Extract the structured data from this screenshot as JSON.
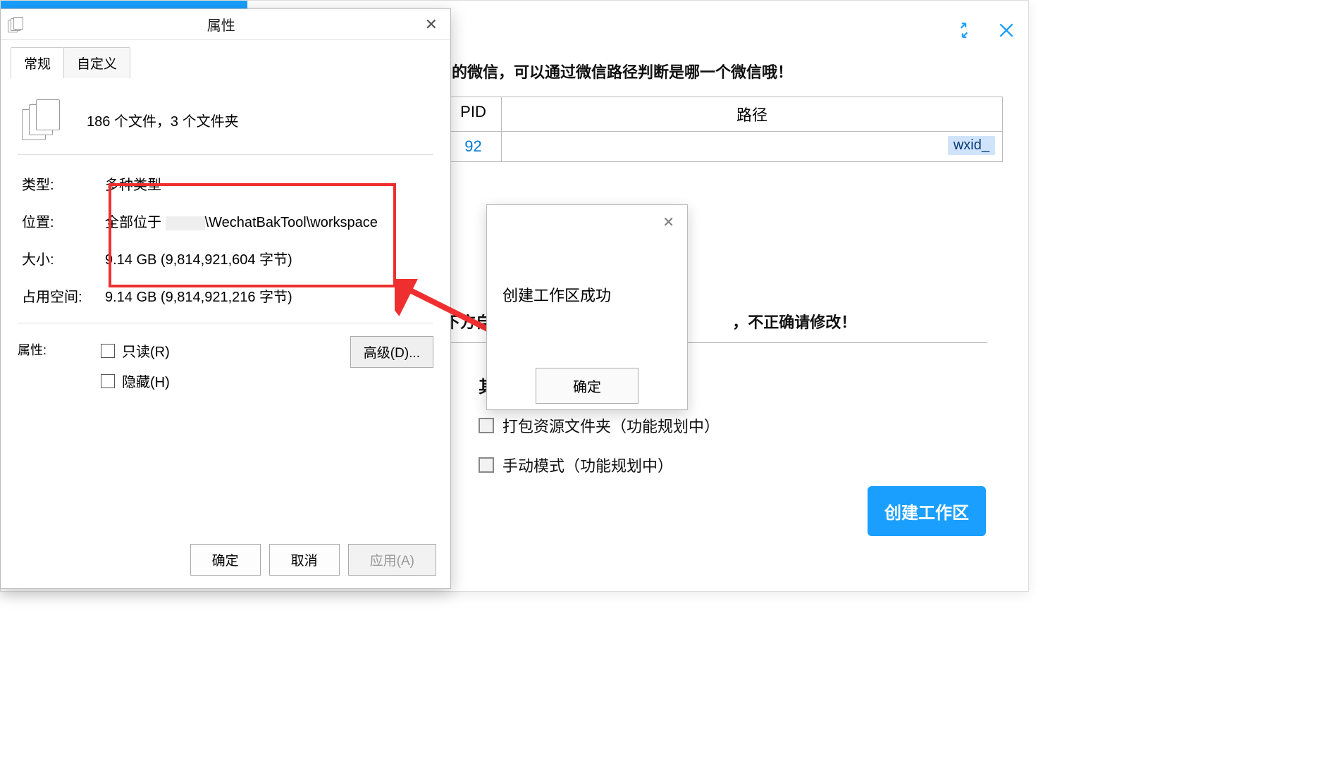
{
  "main": {
    "hint1_tail": "的微信，可以通过微信路径判断是哪一个微信哦！",
    "table": {
      "col_pid": "PID",
      "col_path": "路径",
      "pid_value_tail": "92",
      "wxid_prefix": "wxid_"
    },
    "hint2_left": "下方自",
    "hint2_right": "，不正确请修改！",
    "opt_group": "其",
    "opt1": "打包资源文件夹（功能规划中）",
    "opt2": "手动模式（功能规划中）",
    "create_btn": "创建工作区",
    "min_title": "最小化",
    "close_title": "关闭"
  },
  "props": {
    "title": "属性",
    "tabs": {
      "general": "常规",
      "custom": "自定义"
    },
    "summary": "186 个文件，3 个文件夹",
    "type_label": "类型:",
    "type_value": "多种类型",
    "loc_label": "位置:",
    "loc_prefix": "全部位于",
    "loc_value_tail": "\\WechatBakTool\\workspace",
    "size_label": "大小:",
    "size_value": "9.14 GB (9,814,921,604 字节)",
    "disk_label": "占用空间:",
    "disk_value": "9.14 GB (9,814,921,216 字节)",
    "attr_label": "属性:",
    "readonly": "只读(R)",
    "hidden": "隐藏(H)",
    "advanced": "高级(D)...",
    "ok": "确定",
    "cancel": "取消",
    "apply": "应用(A)"
  },
  "modal": {
    "msg": "创建工作区成功",
    "ok": "确定"
  }
}
